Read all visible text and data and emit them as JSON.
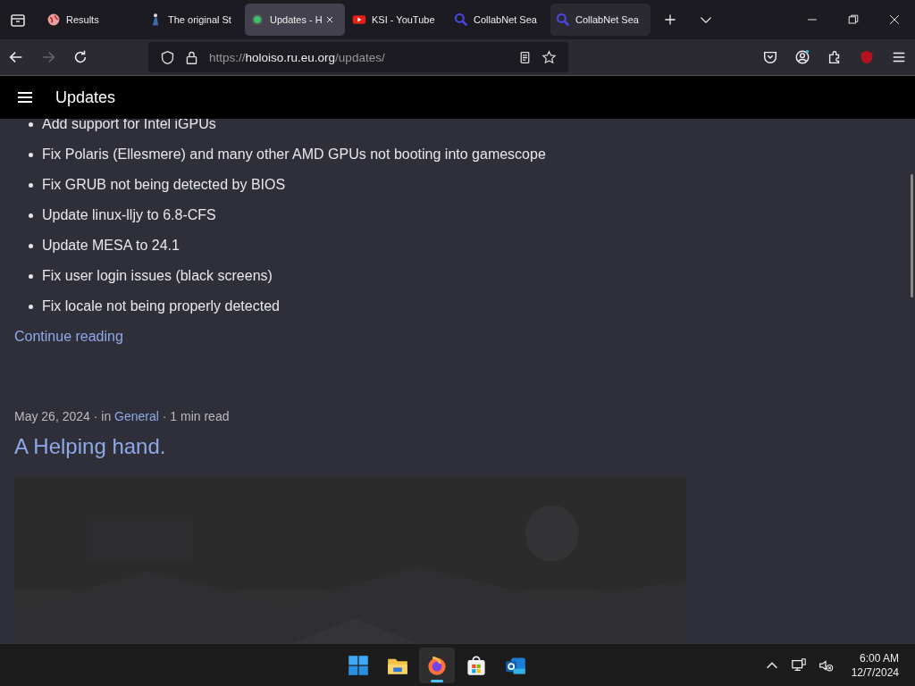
{
  "browser": {
    "tabs": [
      {
        "title": "Results",
        "selected": false
      },
      {
        "title": "The original St",
        "selected": false
      },
      {
        "title": "Updates - H",
        "selected": true,
        "closable": true
      },
      {
        "title": "KSI - YouTube",
        "selected": false
      },
      {
        "title": "CollabNet Sea",
        "selected": false
      },
      {
        "title": "CollabNet Sea",
        "selected": false,
        "hovered": true
      }
    ],
    "url": {
      "prefix": "https://",
      "host": "holoiso.ru.eu.org",
      "path": "/updates/"
    }
  },
  "site_header": {
    "title": "Updates"
  },
  "post": {
    "changes": [
      "Add support for Intel iGPUs",
      "Fix Polaris (Ellesmere) and many other AMD GPUs not booting into gamescope",
      "Fix GRUB not being detected by BIOS",
      "Update linux-lljy to 6.8-CFS",
      "Update MESA to 24.1",
      "Fix user login issues (black screens)",
      "Fix locale not being properly detected"
    ],
    "continue_link": "Continue reading"
  },
  "next_post": {
    "date": "May 26, 2024",
    "in": " · in ",
    "category": "General",
    "read_time": " · 1 min read",
    "title": "A Helping hand."
  },
  "taskbar": {
    "apps": [
      {
        "selected": false
      },
      {
        "selected": false
      },
      {
        "selected": true
      },
      {
        "selected": false
      },
      {
        "selected": false
      }
    ],
    "time": "6:00 AM",
    "date": "12/7/2024"
  }
}
